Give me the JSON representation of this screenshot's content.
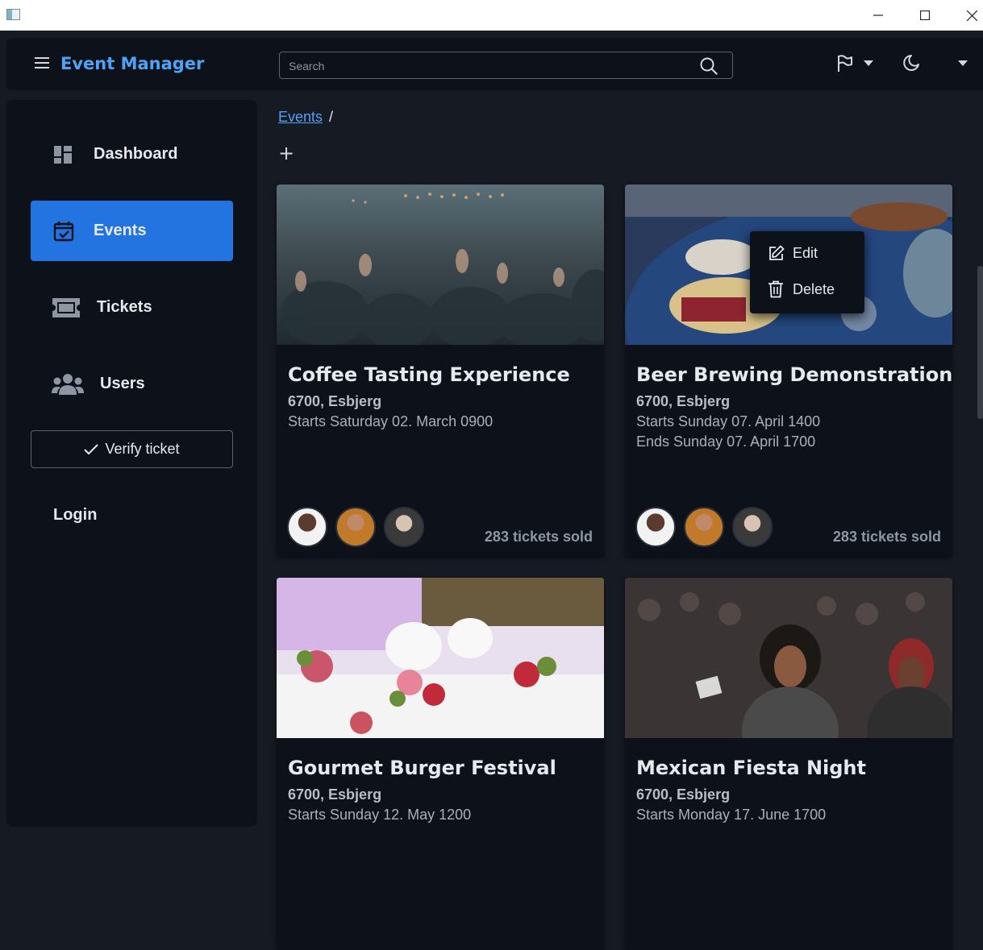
{
  "window": {
    "minimize": "—",
    "maximize": "☐",
    "close": "✕"
  },
  "header": {
    "brand": "Event Manager",
    "search_placeholder": "Search"
  },
  "sidebar": {
    "items": [
      {
        "label": "Dashboard",
        "icon": "dashboard-icon",
        "active": false
      },
      {
        "label": "Events",
        "icon": "calendar-icon",
        "active": true
      },
      {
        "label": "Tickets",
        "icon": "ticket-icon",
        "active": false
      },
      {
        "label": "Users",
        "icon": "users-icon",
        "active": false
      }
    ],
    "verify_label": "Verify ticket",
    "login_label": "Login"
  },
  "breadcrumb": {
    "root": "Events",
    "separator": "/"
  },
  "add_button": "+",
  "context_menu": {
    "edit": "Edit",
    "delete": "Delete"
  },
  "events": [
    {
      "title": "Coffee Tasting Experience",
      "location": "6700, Esbjerg",
      "start": "Starts Saturday 02. March 0900",
      "end": "",
      "sold": "283 tickets sold"
    },
    {
      "title": "Beer Brewing Demonstration",
      "location": "6700, Esbjerg",
      "start": "Starts Sunday 07. April 1400",
      "end": "Ends Sunday 07. April 1700",
      "sold": "283 tickets sold"
    },
    {
      "title": "Gourmet Burger Festival",
      "location": "6700, Esbjerg",
      "start": "Starts Sunday 12. May 1200",
      "end": "",
      "sold": ""
    },
    {
      "title": "Mexican Fiesta Night",
      "location": "6700, Esbjerg",
      "start": "Starts Monday 17. June 1700",
      "end": "",
      "sold": ""
    }
  ],
  "colors": {
    "accent": "#2374e1",
    "brand": "#4fa3f7",
    "surface": "#0d1119",
    "background": "#161a22"
  }
}
